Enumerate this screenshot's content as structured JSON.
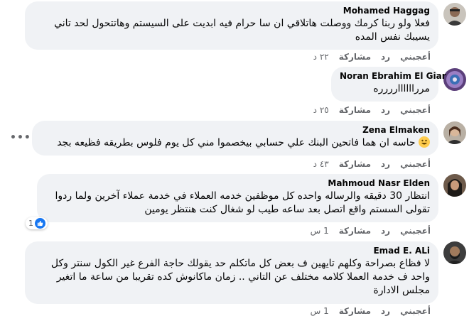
{
  "actions": {
    "like": "أعجبني",
    "reply": "رد",
    "share": "مشاركة"
  },
  "comments": [
    {
      "name": "Mohamed Haggag",
      "text": "فعلا ولو ربنا كرمك ووصلت هاتلاقي ان سا حرام فيه ابديت على السيستم وهاتتحول لحد تاني يسيبك نفس المده",
      "time": "٢٢ د"
    },
    {
      "name": "Noran Ebrahim El Giar",
      "text": "مرراااااارررره",
      "time": "٢٥ د"
    },
    {
      "name": "Zena Elmaken",
      "text": "حاسه ان هما فاتحين البنك علي حسابي بيخصموا مني كل يوم فلوس بطريقه فظيعه بجد",
      "time": "٤٣ د"
    },
    {
      "name": "Mahmoud Nasr Elden",
      "text": "انتظار 30 دقيقه والرساله واحده كل موظفين خدمه العملاء في خدمة عملاء آخرين ولما ردوا تقولى السستم واقع اتصل بعد ساعه طيب لو شغال كنت هنتظر يومين",
      "time": "1 س",
      "reaction_count": "1"
    },
    {
      "name": "Emad E. ALi",
      "text": "لا فظاع بصراحة وكلهم تايهين ف بعض كل ماتكلم حد يقولك حاجة الفرع غير الكول سنتر وكل واحد ف خدمة العملا كلامه مختلف عن التاني .. زمان ماكانوش كده تقريبا من ساعة ما اتغير مجلس الادارة",
      "time": "1 س"
    }
  ],
  "icons": {
    "more": "more-options-icon",
    "like_reaction": "like-reaction-icon",
    "emoji": "grinning-emoji-icon"
  },
  "colors": {
    "bubble": "#f0f2f5",
    "action_text": "#65676b",
    "like_blue": "#1877f2"
  }
}
